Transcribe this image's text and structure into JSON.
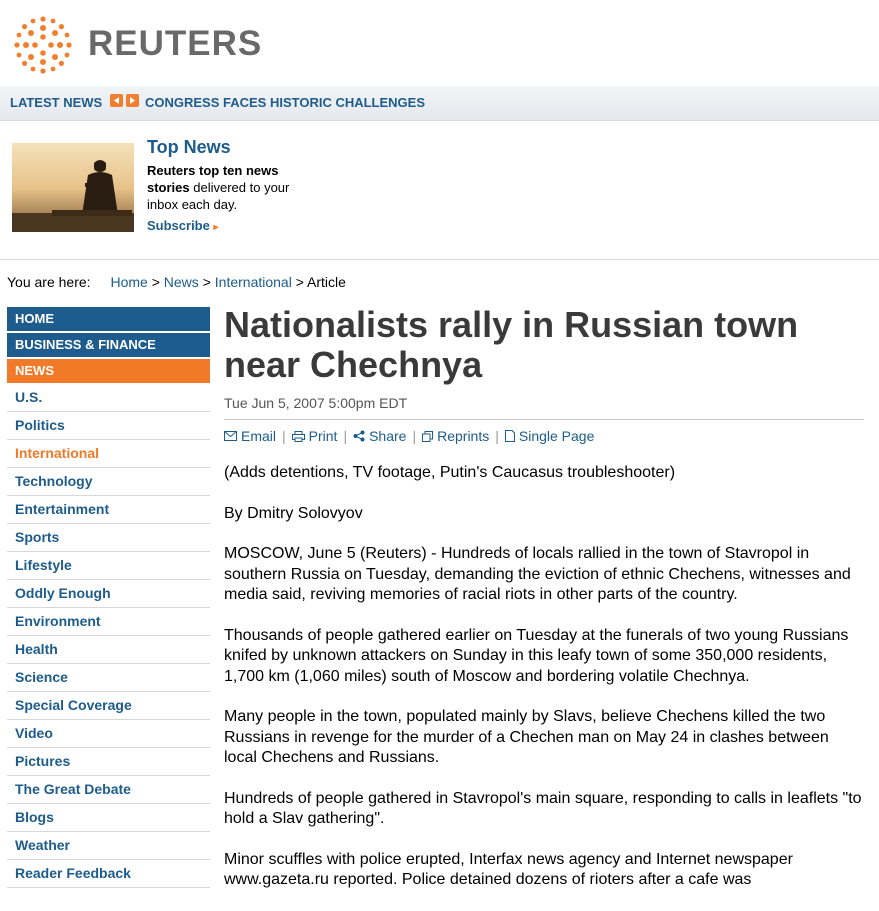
{
  "header": {
    "logo_text": "REUTERS",
    "logo_color": "#f08030"
  },
  "latest_news": {
    "label": "LATEST NEWS",
    "headline": "CONGRESS FACES HISTORIC CHALLENGES"
  },
  "promo": {
    "title": "Top News",
    "text_bold": "Reuters top ten news stories",
    "text_rest": " delivered to your inbox each day.",
    "subscribe": "Subscribe"
  },
  "breadcrumb": {
    "label": "You are here:",
    "items": [
      "Home",
      "News",
      "International"
    ],
    "current": "Article",
    "separator": ">"
  },
  "sidebar": {
    "main": [
      "HOME",
      "BUSINESS & FINANCE",
      "NEWS"
    ],
    "items": [
      "U.S.",
      "Politics",
      "International",
      "Technology",
      "Entertainment",
      "Sports",
      "Lifestyle",
      "Oddly Enough",
      "Environment",
      "Health",
      "Science",
      "Special Coverage",
      "Video",
      "Pictures",
      "The Great Debate",
      "Blogs",
      "Weather",
      "Reader Feedback"
    ]
  },
  "article": {
    "headline": "Nationalists rally in Russian town near Chechnya",
    "date": "Tue Jun 5, 2007 5:00pm EDT",
    "tools": [
      "Email",
      "Print",
      "Share",
      "Reprints",
      "Single Page"
    ],
    "paragraphs": [
      "(Adds detentions, TV footage, Putin's Caucasus troubleshooter)",
      "By Dmitry Solovyov",
      "MOSCOW, June 5 (Reuters) - Hundreds of locals rallied in the town of Stavropol in southern Russia on Tuesday, demanding the eviction of ethnic Chechens, witnesses and media said, reviving memories of racial riots in other parts of the country.",
      "Thousands of people gathered earlier on Tuesday at the funerals of two young Russians knifed by unknown attackers on Sunday in this leafy town of some 350,000 residents, 1,700 km (1,060 miles) south of Moscow and bordering volatile Chechnya.",
      "Many people in the town, populated mainly by Slavs, believe Chechens killed the two Russians in revenge for the murder of a Chechen man on May 24 in clashes between local Chechens and Russians.",
      "Hundreds of people gathered in Stavropol's main square, responding to calls in leaflets \"to hold a Slav gathering\".",
      "Minor scuffles with police erupted, Interfax news agency and Internet newspaper www.gazeta.ru reported. Police detained dozens of rioters after a cafe was"
    ]
  },
  "colors": {
    "link_blue": "#1d5c8c",
    "accent_orange": "#f07a28"
  }
}
